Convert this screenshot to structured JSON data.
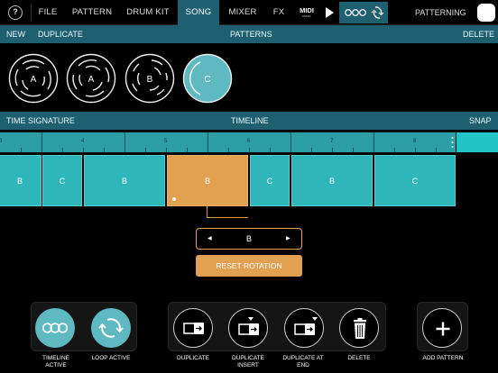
{
  "topbar": {
    "help_icon": "?",
    "tabs": [
      {
        "label": "FILE"
      },
      {
        "label": "PATTERN"
      },
      {
        "label": "DRUM KIT"
      },
      {
        "label": "SONG",
        "active": true
      },
      {
        "label": "MIXER"
      },
      {
        "label": "FX"
      }
    ],
    "midi_label": "MIDI",
    "patterning_label": "PATTERNING"
  },
  "patterns_bar": {
    "new_label": "NEW",
    "duplicate_label": "DUPLICATE",
    "title": "PATTERNS",
    "delete_label": "DELETE"
  },
  "patterns": [
    {
      "label": "A",
      "selected": false
    },
    {
      "label": "A",
      "selected": false
    },
    {
      "label": "B",
      "selected": false
    },
    {
      "label": "C",
      "selected": true
    }
  ],
  "timeline_bar": {
    "time_signature_label": "TIME SIGNATURE",
    "title": "TIMELINE",
    "snap_label": "SNAP"
  },
  "ruler": {
    "numbers": [
      "3",
      "4",
      "5",
      "6",
      "7",
      "8"
    ]
  },
  "timeline_blocks": [
    {
      "label": "B",
      "selected": false
    },
    {
      "label": "C",
      "selected": false
    },
    {
      "label": "B",
      "selected": false
    },
    {
      "label": "B",
      "selected": true
    },
    {
      "label": "C",
      "selected": false
    },
    {
      "label": "B",
      "selected": false
    },
    {
      "label": "C",
      "selected": false
    }
  ],
  "rotation": {
    "left_arrow": "◀",
    "value": "B",
    "right_arrow": "▶",
    "reset_label": "RESET ROTATION"
  },
  "bottom": {
    "timeline_active_label": "TIMELINE ACTIVE",
    "loop_active_label": "LOOP ACTIVE",
    "duplicate_label": "DUPLICATE",
    "duplicate_insert_label": "DUPLICATE INSERT",
    "duplicate_at_end_label": "DUPLICATE AT END",
    "delete_label": "DELETE",
    "add_pattern_label": "ADD PATTERN"
  },
  "colors": {
    "accent_teal": "#1e6070",
    "block_teal": "#2fb6bb",
    "selected_orange": "#e2a150"
  }
}
